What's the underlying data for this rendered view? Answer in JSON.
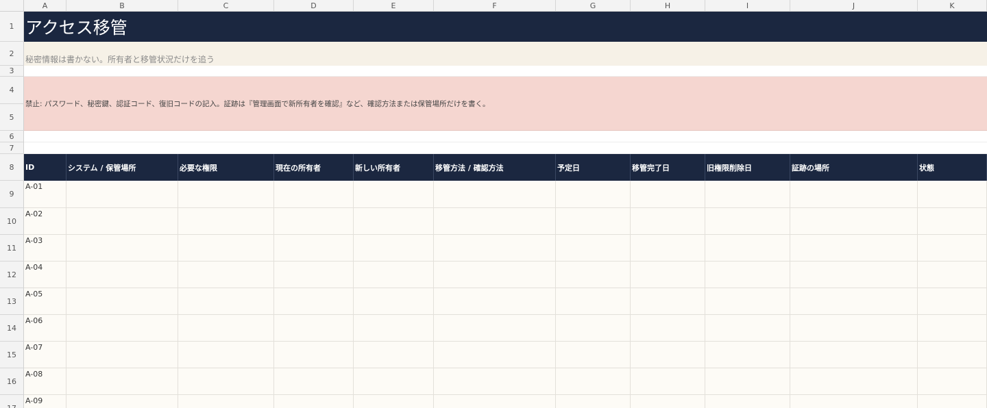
{
  "columns": [
    "A",
    "B",
    "C",
    "D",
    "E",
    "F",
    "G",
    "H",
    "I",
    "J",
    "K"
  ],
  "rows": [
    "1",
    "2",
    "3",
    "4",
    "5",
    "6",
    "7",
    "8",
    "9",
    "10",
    "11",
    "12",
    "13",
    "14",
    "15",
    "16",
    "17"
  ],
  "sheet": {
    "title": "アクセス移管",
    "subtitle": "秘密情報は書かない。所有者と移管状況だけを追う",
    "warning": "禁止: パスワード、秘密鍵、認証コード、復旧コードの記入。証跡は『管理画面で新所有者を確認』など、確認方法または保管場所だけを書く。"
  },
  "table": {
    "headers": [
      "ID",
      "システム / 保管場所",
      "必要な権限",
      "現在の所有者",
      "新しい所有者",
      "移管方法 / 確認方法",
      "予定日",
      "移管完了日",
      "旧権限削除日",
      "証跡の場所",
      "状態"
    ],
    "ids": [
      "A-01",
      "A-02",
      "A-03",
      "A-04",
      "A-05",
      "A-06",
      "A-07",
      "A-08",
      "A-09"
    ]
  },
  "colors": {
    "header_navy": "#1b2740",
    "subtitle_bg": "#f6f1e7",
    "warning_bg": "#f5d6d0",
    "cell_bg": "#fdfbf6"
  }
}
